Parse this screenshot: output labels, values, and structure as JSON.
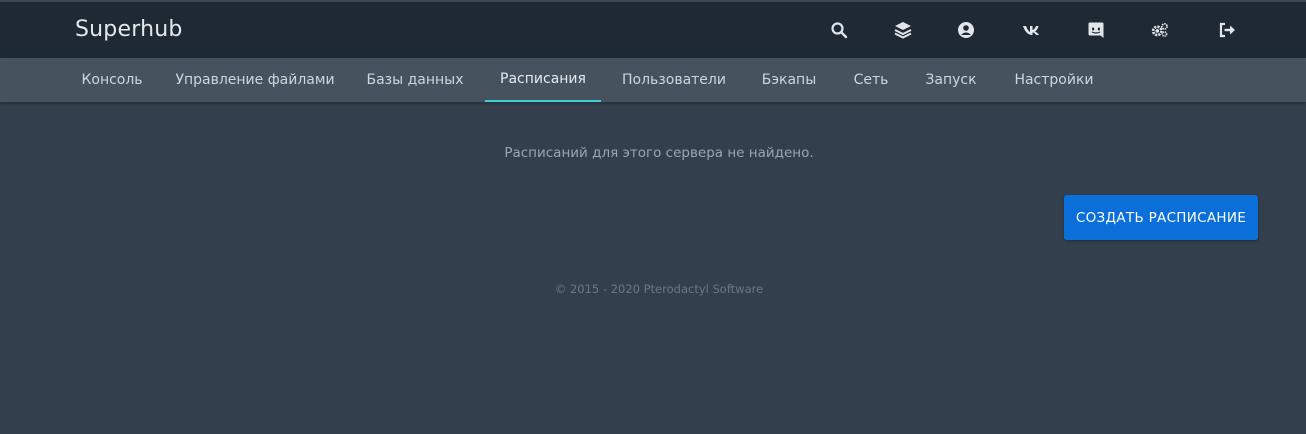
{
  "header": {
    "brand": "Superhub",
    "icons": [
      "search-icon",
      "layers-icon",
      "account-icon",
      "vk-icon",
      "discord-icon",
      "settings-icon",
      "logout-icon"
    ]
  },
  "nav": {
    "tabs": [
      {
        "label": "Консоль",
        "active": false
      },
      {
        "label": "Управление файлами",
        "active": false
      },
      {
        "label": "Базы данных",
        "active": false
      },
      {
        "label": "Расписания",
        "active": true
      },
      {
        "label": "Пользователи",
        "active": false
      },
      {
        "label": "Бэкапы",
        "active": false
      },
      {
        "label": "Сеть",
        "active": false
      },
      {
        "label": "Запуск",
        "active": false
      },
      {
        "label": "Настройки",
        "active": false
      }
    ],
    "active_color": "#3fd0d4"
  },
  "main": {
    "empty_message": "Расписаний для этого сервера не найдено.",
    "create_button": "СОЗДАТЬ РАСПИСАНИЕ"
  },
  "footer": {
    "text": "© 2015 - 2020 Pterodactyl Software"
  },
  "colors": {
    "topbar": "#1f2933",
    "subnav": "#46535f",
    "background": "#333f4d",
    "primary": "#0b6fd9"
  }
}
